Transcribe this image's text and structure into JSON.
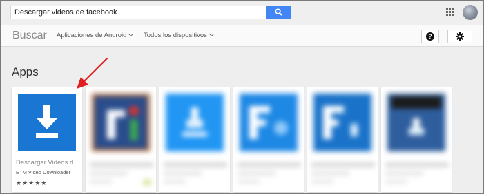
{
  "search": {
    "value": "Descargar videos de facebook"
  },
  "nav": {
    "brand": "Buscar",
    "dropdown_android": "Aplicaciones de Android",
    "dropdown_devices": "Todos los dispositivos",
    "help_label": "?"
  },
  "section": {
    "title": "Apps"
  },
  "cards": [
    {
      "title": "Descargar Videos d",
      "developer": "ETM Video Downloader",
      "rating_stars": "★★★★★",
      "icon_color": "#1976d2"
    },
    {
      "icon_color": "#2a4d8c"
    },
    {
      "icon_color": "#2196f3"
    },
    {
      "icon_color": "#1e88e5"
    },
    {
      "icon_color": "#1a73c9"
    },
    {
      "icon_color": "#2e5e9e"
    }
  ],
  "colors": {
    "accent": "#4285f4",
    "annotation_arrow": "#e02020"
  }
}
